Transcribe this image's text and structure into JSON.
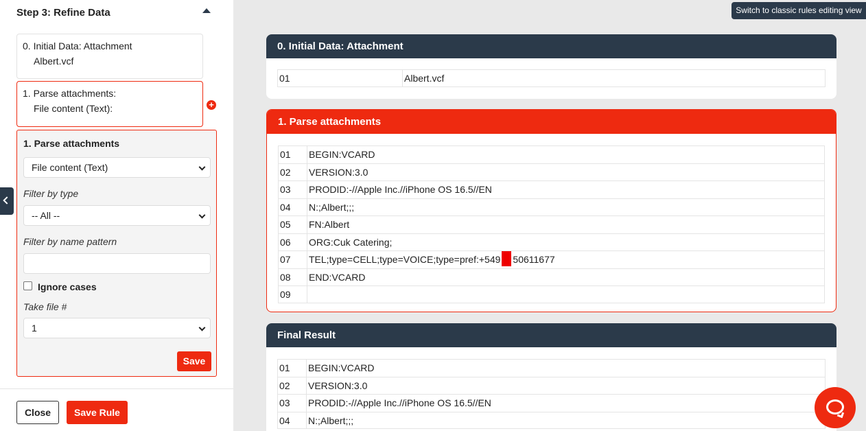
{
  "sidebar": {
    "step_title": "Step 3: Refine Data",
    "step0": {
      "line1": "0. Initial Data: Attachment",
      "line2": "Albert.vcf"
    },
    "step1": {
      "line1": "1. Parse attachments:",
      "line2": "File content (Text):"
    },
    "editor": {
      "title": "1. Parse attachments",
      "content_select": "File content (Text)",
      "filter_type_label": "Filter by type",
      "filter_type_value": "-- All --",
      "filter_name_label": "Filter by name pattern",
      "filter_name_value": "",
      "ignore_cases_label": "Ignore cases",
      "ignore_cases_checked": false,
      "take_file_label": "Take file #",
      "take_file_value": "1",
      "save_label": "Save"
    },
    "close_label": "Close",
    "save_rule_label": "Save Rule"
  },
  "classic_view_label": "Switch to classic rules editing view",
  "panels": {
    "initial": {
      "title": "0. Initial Data: Attachment",
      "rows": [
        {
          "num": "01",
          "val": "Albert.vcf"
        }
      ]
    },
    "parse": {
      "title": "1. Parse attachments",
      "rows": [
        {
          "num": "01",
          "val": "BEGIN:VCARD"
        },
        {
          "num": "02",
          "val": "VERSION:3.0"
        },
        {
          "num": "03",
          "val": "PRODID:-//Apple Inc.//iPhone OS 16.5//EN"
        },
        {
          "num": "04",
          "val": "N:;Albert;;;"
        },
        {
          "num": "05",
          "val": "FN:Albert"
        },
        {
          "num": "06",
          "val": "ORG:Cuk Catering;"
        },
        {
          "num": "07",
          "val_pre": "TEL;type=CELL;type=VOICE;type=pref:+549",
          "val_post": "50611677"
        },
        {
          "num": "08",
          "val": "END:VCARD"
        },
        {
          "num": "09",
          "val": ""
        }
      ]
    },
    "final": {
      "title": "Final Result",
      "rows": [
        {
          "num": "01",
          "val": "BEGIN:VCARD"
        },
        {
          "num": "02",
          "val": "VERSION:3.0"
        },
        {
          "num": "03",
          "val": "PRODID:-//Apple Inc.//iPhone OS 16.5//EN"
        },
        {
          "num": "04",
          "val": "N:;Albert;;;"
        }
      ]
    }
  },
  "colors": {
    "accent": "#ee2a10",
    "header_dark": "#2b3a4a"
  }
}
